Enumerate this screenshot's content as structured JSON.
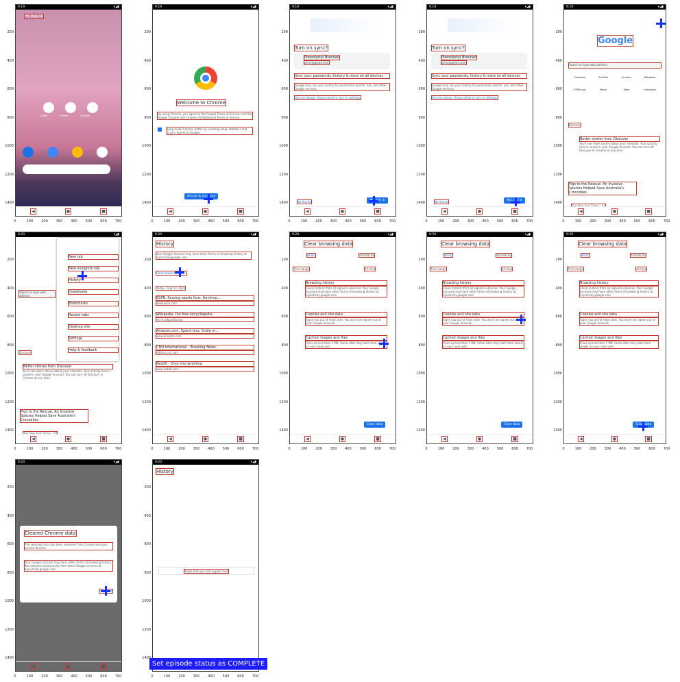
{
  "axis": {
    "y": [
      "200",
      "400",
      "600",
      "800",
      "1000",
      "1200",
      "1400"
    ],
    "x": [
      "0",
      "100",
      "200",
      "300",
      "400",
      "500",
      "600",
      "700"
    ]
  },
  "frames": {
    "f1": {
      "time": "9:19",
      "banner": "Fri, Aug 19",
      "apps": [
        "Gmail",
        "Photos",
        "YouTube"
      ]
    },
    "f2": {
      "time": "9:19",
      "title": "Welcome to Chrome",
      "terms": "By using Chrome, you agree to the Google Terms of Service, and the Google Chrome and Chrome OS Additional Terms of Service",
      "checkbox": "Help make Chrome better by sending usage statistics and crash reports to Google.",
      "button": "Accept & continue"
    },
    "f3": {
      "time": "9:19",
      "title": "Turn on sync?",
      "name": "Pterodactyl Brennan",
      "email": "ptero@gmail.com",
      "body": "Sync your passwords, history & more on all devices",
      "note": "Google may use your history to personalize Search, ads, and other Google services",
      "settings": "You can always choose what to sync in settings.",
      "no": "No thanks",
      "yes": "Yes, I'm in"
    },
    "f4": {
      "time": "9:19",
      "title": "Turn on sync?",
      "name": "Pterodactyl Brennan",
      "email": "ptero@gmail.com",
      "body": "Sync your passwords, history & more on all devices",
      "note": "Google may use your history to personalize Search, ads, and other Google services",
      "settings": "You can always choose what to sync in settings.",
      "no": "No thanks",
      "yes": "Yes, I'm in"
    },
    "f5": {
      "time": "9:19",
      "logo": "Google",
      "search": "Search or type web address",
      "shortcuts": [
        "Facebook",
        "YouTube",
        "Amazon",
        "Wikipedia",
        "ESPN.com",
        "Yahoo",
        "Ebay",
        "Instagram"
      ],
      "discover": "Discover",
      "card_title": "Better stories from Discover",
      "card_body": "You'll see more stories about your interests. Your activity here is saved in your Google Account. You can turn off Discover in Chrome at any time.",
      "news": "Pigs to the Rescue: An Invasive Species Helped Save Australia's Crocodiles",
      "source": "The New York Times · 1d"
    },
    "f6": {
      "time": "9:20",
      "menu": [
        "New tab",
        "New incognito tab",
        "History",
        "Downloads",
        "Bookmarks",
        "Recent tabs",
        "Desktop site",
        "Settings",
        "Help & feedback"
      ],
      "search": "Search or type web address",
      "discover": "Discover",
      "card_title": "Better stories from Discover",
      "card_body": "You'll see more stories about your interests. Your activity here is saved in your Google Account. You can turn off Discover in Chrome at any time.",
      "news": "Pigs to the Rescue: An Invasive Species Helped Save Australia's Crocodiles",
      "source": "The New York Times · 1d"
    },
    "f7": {
      "time": "9:20",
      "title": "History",
      "note": "Your Google Account may have other forms of browsing history at myactivity.google.com",
      "clear": "Clear browsing data...",
      "date": "Today - Aug 19, 2022",
      "items": [
        {
          "title": "ESPN: Serving sports fans. Anytime...",
          "url": "www.espn.com"
        },
        {
          "title": "Wikipedia, the free encyclopedia",
          "url": "en.m.wikipedia.org"
        },
        {
          "title": "Amazon.com. Spend less. Smile m...",
          "url": "www.amazon.com"
        },
        {
          "title": "CNN International - Breaking News...",
          "url": "edition.cnn.com"
        },
        {
          "title": "Reddit - Dive into anything",
          "url": "www.reddit.com"
        }
      ]
    },
    "cbd": {
      "time": "9:20",
      "title": "Clear browsing data",
      "tab_basic": "BASIC",
      "tab_adv": "ADVANCED",
      "range_label": "Time range",
      "range_val": "All time",
      "rows": [
        {
          "title": "Browsing history",
          "desc": "Clears history from all signed-in devices. Your Google Account may have other forms of browsing history at myactivity.google.com"
        },
        {
          "title": "Cookies and site data",
          "desc": "Signs you out of most sites. You won't be signed out of your Google Account."
        },
        {
          "title": "Cached images and files",
          "desc": "Frees up less than 1 MB. Some sites may load more slowly on your next visit."
        }
      ],
      "button": "Clear data"
    },
    "f11": {
      "time": "9:20",
      "dialog_title": "Cleared Chrome data",
      "dialog_p1": "The selected data has been removed from Chrome and your synced devices.",
      "dialog_p2": "Your Google account may have other forms of browsing history like searches and activity from other Google services at myactivity.google.com",
      "ok": "OK, got it"
    },
    "f12": {
      "time": "9:20",
      "title": "History",
      "empty": "Pages that you visit appear here"
    }
  },
  "caption": "Set episode status as COMPLETE",
  "colors": {
    "accent": "#1a73e8",
    "marker": "#1432ff",
    "bbox": "#c0392b"
  }
}
